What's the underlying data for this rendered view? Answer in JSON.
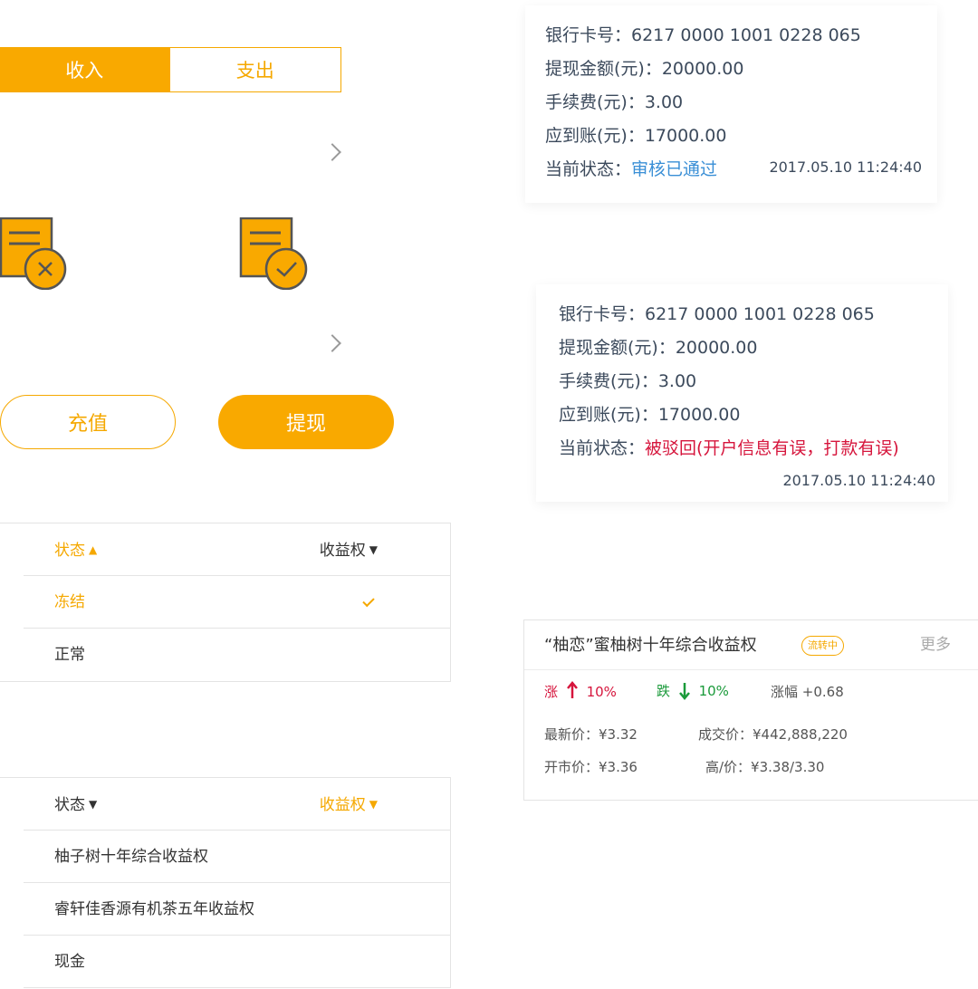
{
  "tabs": {
    "income": "收入",
    "expense": "支出"
  },
  "actions": {
    "recharge": "充值",
    "withdraw": "提现"
  },
  "withdraw_cards": [
    {
      "bank_card": "银行卡号：6217  0000  1001 0228 065",
      "amount": "提现金额(元)：20000.00",
      "fee": "手续费(元)：3.00",
      "credited": "应到账(元)：17000.00",
      "status_label": "当前状态：",
      "status_value": "审核已通过",
      "timestamp": "2017.05.10  11:24:40"
    },
    {
      "bank_card": "银行卡号：6217  0000  1001 0228 065",
      "amount": "提现金额(元)：20000.00",
      "fee": "手续费(元)：3.00",
      "credited": "应到账(元)：17000.00",
      "status_label": "当前状态：",
      "status_value": "被驳回(开户信息有误，打款有误)",
      "timestamp": "2017.05.10  11:24:40"
    }
  ],
  "status_dropdown": {
    "header_left": "状态",
    "header_right": "收益权",
    "items": [
      "冻结",
      "正常"
    ]
  },
  "rights_dropdown": {
    "header_left": "状态",
    "header_right": "收益权",
    "items": [
      "柚子树十年综合收益权",
      "睿轩佳香源有机茶五年收益权",
      "现金"
    ]
  },
  "market": {
    "title": "“柚恋”蜜柚树十年综合收益权",
    "badge": "流转中",
    "more": "更多",
    "rise_label": "涨",
    "rise_value": "10%",
    "fall_label": "跌",
    "fall_value": "10%",
    "change": "涨幅  +0.68",
    "latest_price": "最新价：¥3.32",
    "deal_price": "成交价：¥442,888,220",
    "open_price": "开市价：¥3.36",
    "high_low": "高/价：¥3.38/3.30"
  },
  "colors": {
    "accent": "#f9a900",
    "approved": "#3a8fd6",
    "rejected": "#d6153c",
    "down": "#1a9a3a"
  }
}
